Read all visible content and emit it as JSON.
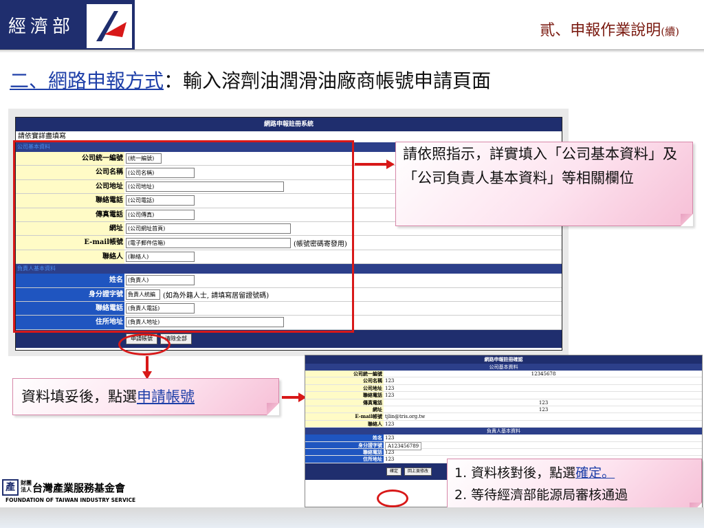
{
  "header": {
    "ministry_name": "經濟部",
    "section_title": "貳、申報作業說明",
    "section_suffix": "(續)"
  },
  "main_title": {
    "link_part": "二、網路申報方式",
    "rest": "：輸入溶劑油潤滑油廠商帳號申請頁面"
  },
  "form": {
    "title": "網路申報註冊系統",
    "instruction": "請依實詳盡填寫",
    "company_section": "公司基本資料",
    "owner_section": "負責人基本資料",
    "company_fields": [
      {
        "label": "公司統一編號",
        "placeholder": "(統一編號)",
        "note": ""
      },
      {
        "label": "公司名稱",
        "placeholder": "(公司名稱)",
        "note": ""
      },
      {
        "label": "公司地址",
        "placeholder": "(公司地址)",
        "note": ""
      },
      {
        "label": "聯絡電話",
        "placeholder": "(公司電話)",
        "note": ""
      },
      {
        "label": "傳真電話",
        "placeholder": "(公司傳真)",
        "note": ""
      },
      {
        "label": "網址",
        "placeholder": "(公司網址首頁)",
        "note": ""
      },
      {
        "label": "E-mail帳號",
        "placeholder": "(電子郵件信箱)",
        "note": "(帳號密碼寄發用)"
      },
      {
        "label": "聯絡人",
        "placeholder": "(聯絡人)",
        "note": ""
      }
    ],
    "owner_fields": [
      {
        "label": "姓名",
        "placeholder": "(負責人)",
        "note": ""
      },
      {
        "label": "身分證字號",
        "placeholder": "負責人統編",
        "note": "(如為外籍人士, 請填寫居留證號碼)"
      },
      {
        "label": "聯絡電話",
        "placeholder": "(負責人電話)",
        "note": ""
      },
      {
        "label": "住所地址",
        "placeholder": "(負責人地址)",
        "note": ""
      }
    ],
    "apply_button": "申請帳號",
    "clear_button": "清除全部"
  },
  "callout_top": "請依照指示，詳實填入「公司基本資料」及「公司負責人基本資料」等相關欄位",
  "callout_left": {
    "prefix": "資料填妥後，點選",
    "link": "申請帳號"
  },
  "callout_bottom": {
    "line1_prefix": "1. 資料核對後，點選",
    "line1_link": "確定。",
    "line2": "2. 等待經濟部能源局審核通過"
  },
  "confirm": {
    "title": "網路申報註冊確認",
    "company_section": "公司基本資料",
    "owner_section": "負責人基本資料",
    "company_rows": [
      {
        "label": "公司統一編號",
        "value": "12345678",
        "centered": true
      },
      {
        "label": "公司名稱",
        "value": "123",
        "centered": false
      },
      {
        "label": "公司地址",
        "value": "123",
        "centered": false
      },
      {
        "label": "聯絡電話",
        "value": "123",
        "centered": false
      },
      {
        "label": "傳真電話",
        "value": "123",
        "centered": true
      },
      {
        "label": "網址",
        "value": "123",
        "centered": true
      },
      {
        "label": "E-mail帳號",
        "value": "tjlin@tris.org.tw",
        "centered": false
      },
      {
        "label": "聯絡人",
        "value": "123",
        "centered": false
      }
    ],
    "owner_rows": [
      {
        "label": "姓名",
        "value": "123"
      },
      {
        "label": "身分證字號",
        "value": "A123456789"
      },
      {
        "label": "聯絡電話",
        "value": "123"
      },
      {
        "label": "住所地址",
        "value": "123"
      }
    ],
    "confirm_button": "確定",
    "back_button": "回上頁修改"
  },
  "org": {
    "logo_char": "產",
    "small_line1": "財團",
    "small_line2": "法人",
    "name": "台灣產業服務基金會",
    "english": "FOUNDATION OF TAIWAN INDUSTRY SERVICE"
  }
}
